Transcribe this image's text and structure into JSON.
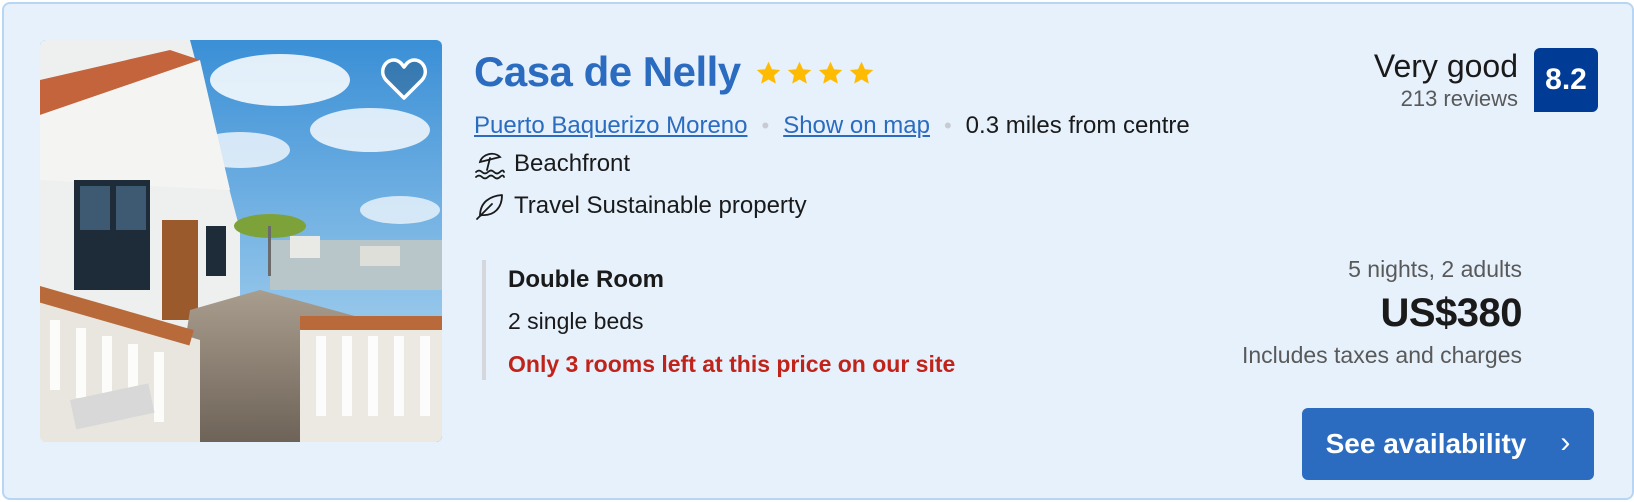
{
  "property": {
    "name": "Casa de Nelly",
    "star_count": 4,
    "star_color": "#febb02",
    "location": "Puerto Baquerizo Moreno",
    "map_link": "Show on map",
    "separator": "•",
    "distance": "0.3 miles from centre",
    "features": [
      {
        "icon": "beach-umbrella-icon",
        "label": "Beachfront"
      },
      {
        "icon": "leaf-icon",
        "label": "Travel Sustainable property"
      }
    ]
  },
  "room": {
    "name": "Double Room",
    "beds": "2 single beds",
    "scarcity": "Only 3 rooms left at this price on our site"
  },
  "rating": {
    "word": "Very good",
    "reviews": "213 reviews",
    "score": "8.2"
  },
  "price": {
    "stay": "5 nights, 2 adults",
    "amount": "US$380",
    "taxes": "Includes taxes and charges"
  },
  "cta": {
    "label": "See availability",
    "chevron": "›"
  },
  "colors": {
    "card_bg": "#e6f1fc",
    "accent": "#2b6bc0",
    "score_bg": "#003b95",
    "scarcity": "#c0231a"
  },
  "icons": {
    "favorite": "heart-icon",
    "star": "star-icon",
    "chevron": "chevron-right-icon"
  }
}
